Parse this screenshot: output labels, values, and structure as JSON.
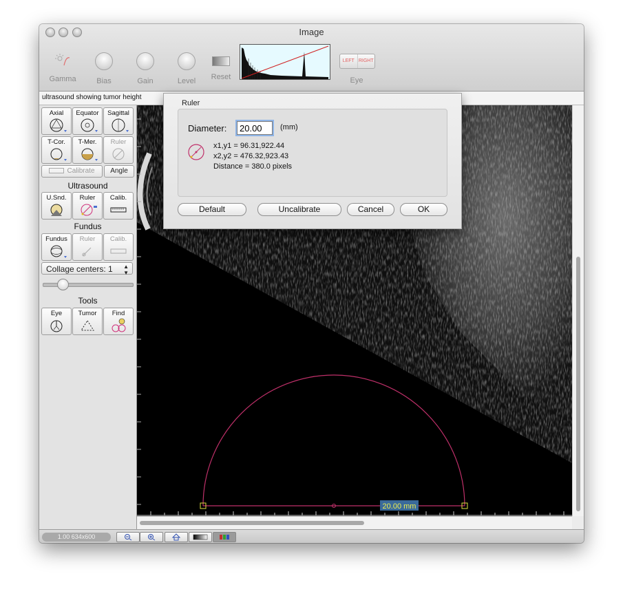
{
  "window": {
    "title": "Image"
  },
  "toolbar": {
    "gamma_label": "Gamma",
    "bias_label": "Bias",
    "gain_label": "Gain",
    "level_label": "Level",
    "reset_label": "Reset",
    "eye_label": "Eye",
    "eye_left": "LEFT",
    "eye_right": "RIGHT"
  },
  "info": {
    "image_name": "ultrasound showing tumor height"
  },
  "panel": {
    "views": [
      {
        "label": "Axial"
      },
      {
        "label": "Equator"
      },
      {
        "label": "Sagittal"
      },
      {
        "label": "T-Cor."
      },
      {
        "label": "T-Mer."
      },
      {
        "label": "Ruler"
      }
    ],
    "calibrate_label": "Calibrate",
    "angle_label": "Angle",
    "ultrasound_heading": "Ultrasound",
    "ultrasound_buttons": [
      {
        "label": "U.Snd."
      },
      {
        "label": "Ruler"
      },
      {
        "label": "Calib."
      }
    ],
    "fundus_heading": "Fundus",
    "fundus_buttons": [
      {
        "label": "Fundus"
      },
      {
        "label": "Ruler"
      },
      {
        "label": "Calib."
      }
    ],
    "collage_label": "Collage centers: 1",
    "tools_heading": "Tools",
    "tools_buttons": [
      {
        "label": "Eye"
      },
      {
        "label": "Tumor"
      },
      {
        "label": "Find"
      }
    ]
  },
  "statusbar": {
    "zoom_info": "1.00 634x600"
  },
  "dialog": {
    "title": "Ruler",
    "diameter_label": "Diameter:",
    "diameter_value": "20.00",
    "unit_label": "(mm)",
    "coords1": "x1,y1 = 96.31,922.44",
    "coords2": "x2,y2 = 476.32,923.43",
    "distance": "Distance = 380.0 pixels",
    "default_label": "Default",
    "uncalibrate_label": "Uncalibrate",
    "cancel_label": "Cancel",
    "ok_label": "OK"
  },
  "overlay": {
    "measurement_label": "20.00 mm",
    "color": "#c0306a"
  }
}
